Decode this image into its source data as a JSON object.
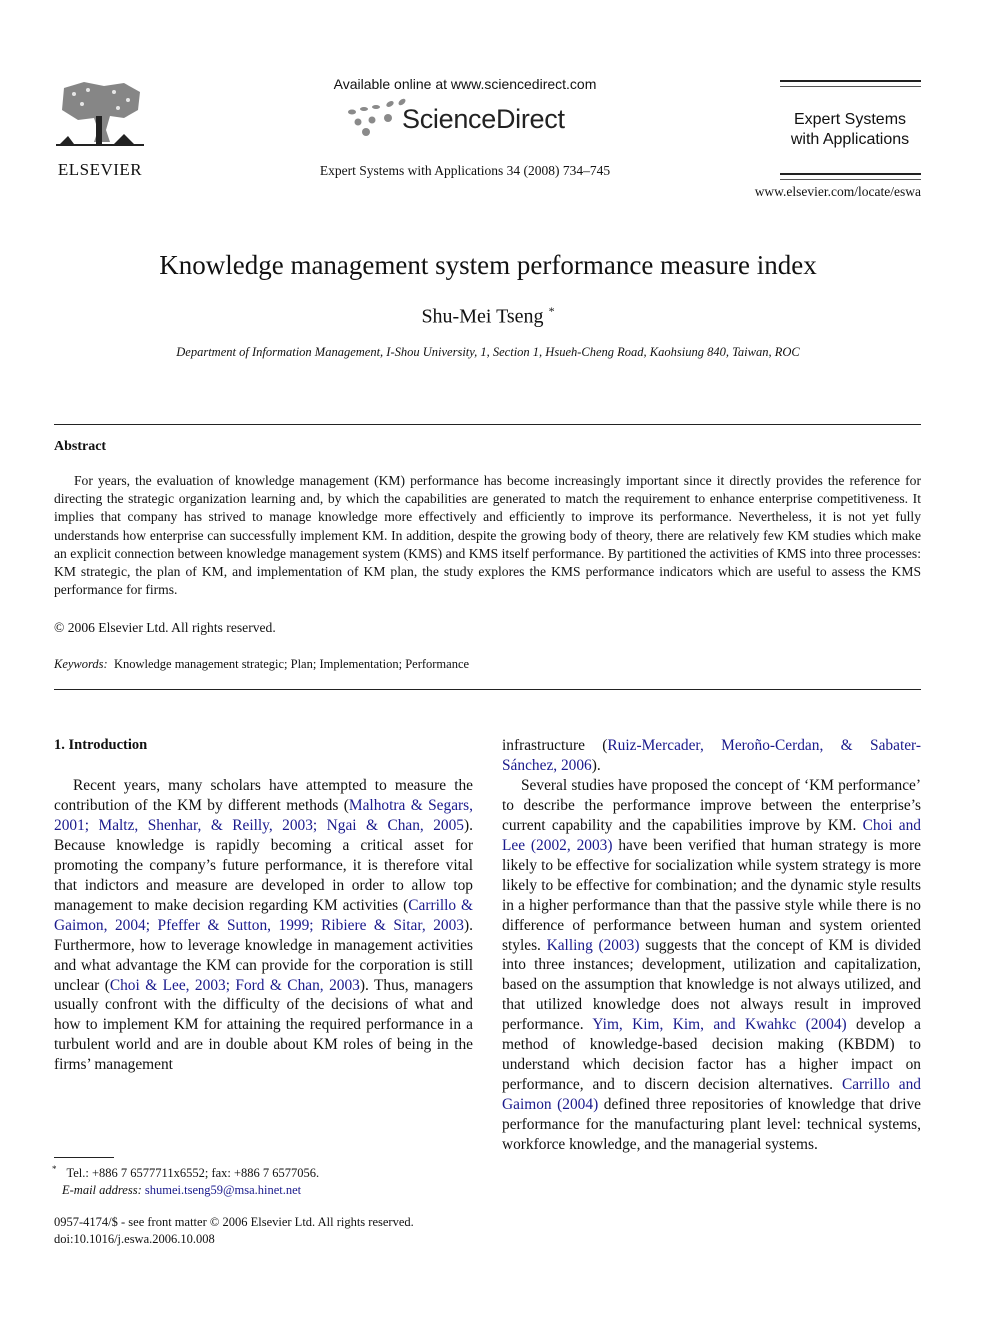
{
  "header": {
    "publisher": "ELSEVIER",
    "available_online": "Available online at www.sciencedirect.com",
    "platform": "ScienceDirect",
    "citation_line": "Expert Systems with Applications 34 (2008) 734–745",
    "journal_name_line1": "Expert Systems",
    "journal_name_line2": "with Applications",
    "journal_url": "www.elsevier.com/locate/eswa",
    "icons": [
      "elsevier-tree-logo",
      "sciencedirect-dots-logo"
    ]
  },
  "article": {
    "title": "Knowledge management system performance measure index",
    "author": "Shu-Mei Tseng",
    "author_mark": "*",
    "affiliation": "Department of Information Management, I-Shou University, 1, Section 1, Hsueh-Cheng Road, Kaohsiung 840, Taiwan, ROC"
  },
  "abstract": {
    "heading": "Abstract",
    "body": "For years, the evaluation of knowledge management (KM) performance has become increasingly important since it directly provides the reference for directing the strategic organization learning and, by which the capabilities are generated to match the requirement to enhance enterprise competitiveness. It implies that company has strived to manage knowledge more effectively and efficiently to improve its performance. Nevertheless, it is not yet fully understands how enterprise can successfully implement KM. In addition, despite the growing body of theory, there are relatively few KM studies which make an explicit connection between knowledge management system (KMS) and KMS itself performance. By partitioned the activities of KMS into three processes: KM strategic, the plan of KM, and implementation of KM plan, the study explores the KMS performance indicators which are useful to assess the KMS performance for firms.",
    "copyright": "© 2006 Elsevier Ltd. All rights reserved.",
    "keywords_label": "Keywords:",
    "keywords": "Knowledge management strategic; Plan; Implementation; Performance"
  },
  "intro": {
    "heading": "1. Introduction",
    "left": {
      "t1": "Recent years, many scholars have attempted to measure the contribution of the KM by different methods (",
      "c1": "Malhotra & Segars, 2001; Maltz, Shenhar, & Reilly, 2003; Ngai & Chan, 2005",
      "t2": "). Because knowledge is rapidly becoming a critical asset for promoting the company’s future performance, it is therefore vital that indictors and measure are developed in order to allow top management to make decision regarding KM activities (",
      "c2": "Carrillo & Gaimon, 2004; Pfeffer & Sutton, 1999; Ribiere & Sitar, 2003",
      "t3": "). Furthermore, how to leverage knowledge in management activities and what advantage the KM can provide for the corporation is still unclear (",
      "c3": "Choi & Lee, 2003; Ford & Chan, 2003",
      "t4": "). Thus, managers usually confront with the difficulty of the decisions of what and how to implement KM for attaining the required performance in a turbulent world and are in double about KM roles of being in the firms’ management"
    },
    "right": {
      "t1": "infrastructure (",
      "c1": "Ruiz-Mercader, Meroño-Cerdan, & Sabater-Sánchez, 2006",
      "t2": ").",
      "p2_t1": "Several studies have proposed the concept of ‘KM performance’ to describe the performance improve between the enterprise’s current capability and the capabilities improve by KM. ",
      "p2_c1": "Choi and Lee (2002, 2003)",
      "p2_t2": " have been verified that human strategy is more likely to be effective for socialization while system strategy is more likely to be effective for combination; and the dynamic style results in a higher performance than that the passive style while there is no difference of performance between human and system oriented styles. ",
      "p2_c2": "Kalling (2003)",
      "p2_t3": " suggests that the concept of KM is divided into three instances; development, utilization and capitalization, based on the assumption that knowledge is not always utilized, and that utilized knowledge does not always result in improved performance. ",
      "p2_c3": "Yim, Kim, Kim, and Kwahkc (2004)",
      "p2_t4": " develop a method of knowledge-based decision making (KBDM) to understand which decision factor has a higher impact on performance, and to discern decision alternatives. ",
      "p2_c4": "Carrillo and Gaimon (2004)",
      "p2_t5": " defined three repositories of knowledge that drive performance for the manufacturing plant level: technical systems, workforce knowledge, and the managerial systems."
    }
  },
  "footnote": {
    "mark": "*",
    "contact": "Tel.: +886 7 6577711x6552; fax: +886 7 6577056.",
    "email_label": "E-mail address:",
    "email": "shumei.tseng59@msa.hinet.net"
  },
  "front_matter": {
    "issn_line": "0957-4174/$ - see front matter © 2006 Elsevier Ltd. All rights reserved.",
    "doi": "doi:10.1016/j.eswa.2006.10.008"
  },
  "colors": {
    "citation_link": "#1a1a8c",
    "text": "#111111"
  }
}
